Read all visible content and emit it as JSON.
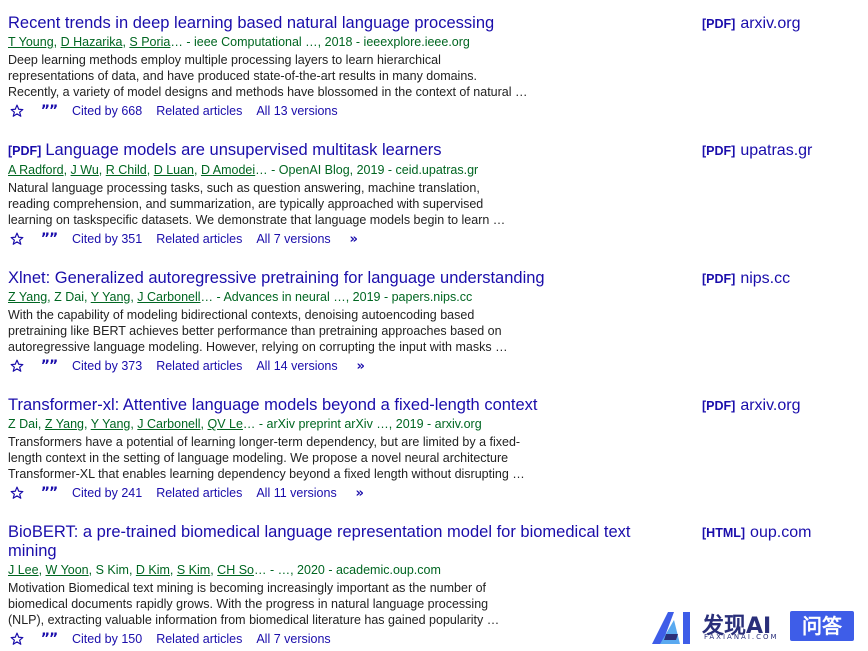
{
  "results": [
    {
      "tag": "",
      "title": "Recent trends in deep learning based natural language processing",
      "authors": [
        {
          "name": "T Young",
          "link": true
        },
        {
          "name": "D Hazarika",
          "link": true
        },
        {
          "name": "S Poria",
          "link": true
        }
      ],
      "source": "… - ieee Computational …, 2018 - ieeexplore.ieee.org",
      "snippet": [
        "Deep learning methods employ multiple processing layers to learn hierarchical",
        "representations of data, and have produced state-of-the-art results in many domains.",
        "Recently, a variety of model designs and methods have blossomed in the context of natural …"
      ],
      "cited": "Cited by 668",
      "related": "Related articles",
      "versions": "All 13 versions",
      "has_more": false,
      "side_tag": "[PDF]",
      "side_domain": "arxiv.org"
    },
    {
      "tag": "[PDF]",
      "title": "Language models are unsupervised multitask learners",
      "authors": [
        {
          "name": "A Radford",
          "link": true
        },
        {
          "name": "J Wu",
          "link": true
        },
        {
          "name": "R Child",
          "link": true
        },
        {
          "name": "D Luan",
          "link": true
        },
        {
          "name": "D Amodei",
          "link": true
        }
      ],
      "source": "… - OpenAI Blog, 2019 - ceid.upatras.gr",
      "snippet": [
        "Natural language processing tasks, such as question answering, machine translation,",
        "reading comprehension, and summarization, are typically approached with supervised",
        "learning on taskspecific datasets. We demonstrate that language models begin to learn …"
      ],
      "cited": "Cited by 351",
      "related": "Related articles",
      "versions": "All 7 versions",
      "has_more": true,
      "side_tag": "[PDF]",
      "side_domain": "upatras.gr"
    },
    {
      "tag": "",
      "title": "Xlnet: Generalized autoregressive pretraining for language understanding",
      "authors": [
        {
          "name": "Z Yang",
          "link": true
        },
        {
          "name": "Z Dai",
          "link": false
        },
        {
          "name": "Y Yang",
          "link": true
        },
        {
          "name": "J Carbonell",
          "link": true
        }
      ],
      "source": "… - Advances in neural …, 2019 - papers.nips.cc",
      "snippet": [
        "With the capability of modeling bidirectional contexts, denoising autoencoding based",
        "pretraining like BERT achieves better performance than pretraining approaches based on",
        "autoregressive language modeling. However, relying on corrupting the input with masks …"
      ],
      "cited": "Cited by 373",
      "related": "Related articles",
      "versions": "All 14 versions",
      "has_more": true,
      "side_tag": "[PDF]",
      "side_domain": "nips.cc"
    },
    {
      "tag": "",
      "title": "Transformer-xl: Attentive language models beyond a fixed-length context",
      "authors": [
        {
          "name": "Z Dai",
          "link": false
        },
        {
          "name": "Z Yang",
          "link": true
        },
        {
          "name": "Y Yang",
          "link": true
        },
        {
          "name": "J Carbonell",
          "link": true
        },
        {
          "name": "QV Le",
          "link": true
        }
      ],
      "source": "… - arXiv preprint arXiv …, 2019 - arxiv.org",
      "snippet": [
        "Transformers have a potential of learning longer-term dependency, but are limited by a fixed-",
        "length context in the setting of language modeling. We propose a novel neural architecture",
        "Transformer-XL that enables learning dependency beyond a fixed length without disrupting …"
      ],
      "cited": "Cited by 241",
      "related": "Related articles",
      "versions": "All 11 versions",
      "has_more": true,
      "side_tag": "[PDF]",
      "side_domain": "arxiv.org"
    },
    {
      "tag": "",
      "title": "BioBERT: a pre-trained biomedical language representation model for biomedical text mining",
      "authors": [
        {
          "name": "J Lee",
          "link": true
        },
        {
          "name": "W Yoon",
          "link": true
        },
        {
          "name": "S Kim",
          "link": false
        },
        {
          "name": "D Kim",
          "link": true
        },
        {
          "name": "S Kim",
          "link": true
        },
        {
          "name": "CH So",
          "link": true
        }
      ],
      "source": "… - …, 2020 - academic.oup.com",
      "snippet": [
        "Motivation Biomedical text mining is becoming increasingly important as the number of",
        "biomedical documents rapidly grows. With the progress in natural language processing",
        "(NLP), extracting valuable information from biomedical literature has gained popularity …"
      ],
      "cited": "Cited by 150",
      "related": "Related articles",
      "versions": "All 7 versions",
      "has_more": false,
      "side_tag": "[HTML]",
      "side_domain": "oup.com"
    }
  ],
  "icons": {
    "save": "star-icon",
    "cite": "quote-icon",
    "more": "double-chevron-right-icon"
  },
  "logo": {
    "brand": "发现AI",
    "sub": "FAXIANAI.COM",
    "qa": "问答"
  },
  "colors": {
    "link": "#1a0dab",
    "green": "#006621",
    "logo_blue": "#3e5de8",
    "logo_dark": "#2a2f7a"
  }
}
